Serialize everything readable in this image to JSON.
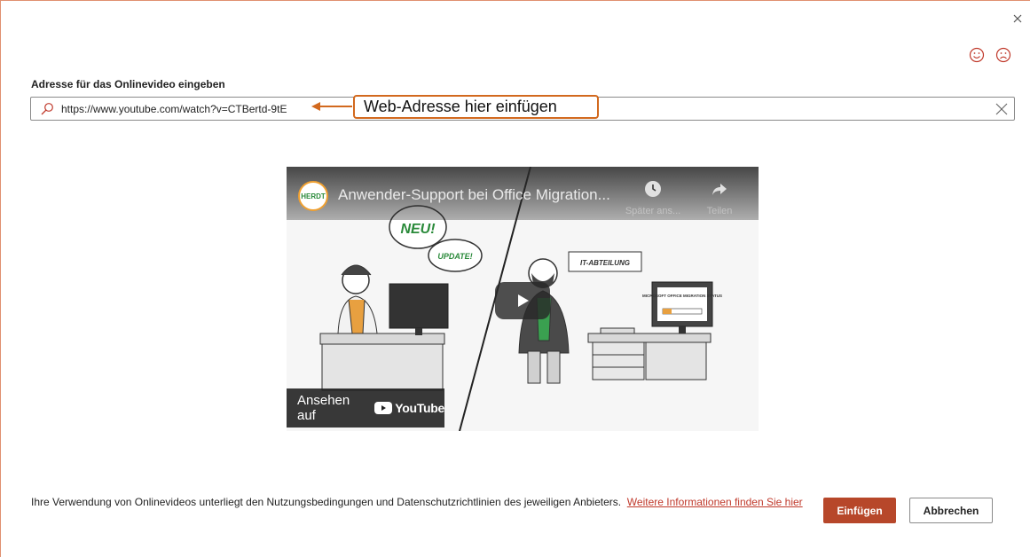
{
  "dialog": {
    "close_icon": "close-icon",
    "feedback": {
      "smile_icon": "smile-icon",
      "frown_icon": "frown-icon"
    }
  },
  "url_field": {
    "label": "Adresse für das Onlinevideo eingeben",
    "value": "https://www.youtube.com/watch?v=CTBertd-9tE",
    "search_icon": "search-icon",
    "clear_icon": "clear-icon"
  },
  "callout": {
    "text": "Web-Adresse hier einfügen",
    "color": "#d2691e"
  },
  "video_preview": {
    "channel_logo": "HERDT",
    "title": "Anwender-Support bei Office Migration...",
    "actions": [
      {
        "label": "Später ans...",
        "icon": "clock-icon"
      },
      {
        "label": "Teilen",
        "icon": "share-icon"
      }
    ],
    "speech_bubbles": [
      "NEU!",
      "UPDATE!"
    ],
    "sign_text": "IT-ABTEILUNG",
    "screen_text": "MICROSOFT OFFICE MIGRATION STATUS",
    "watch_on": {
      "text": "Ansehen auf",
      "brand": "YouTube"
    }
  },
  "footer": {
    "terms_text": "Ihre Verwendung von Onlinevideos unterliegt den Nutzungsbedingungen und Datenschutzrichtlinien des jeweiligen Anbieters.",
    "more_info_link": "Weitere Informationen finden Sie hier",
    "insert_button": "Einfügen",
    "cancel_button": "Abbrechen"
  },
  "colors": {
    "accent": "#b7472a",
    "link": "#c0392b",
    "callout_border": "#d2691e"
  }
}
